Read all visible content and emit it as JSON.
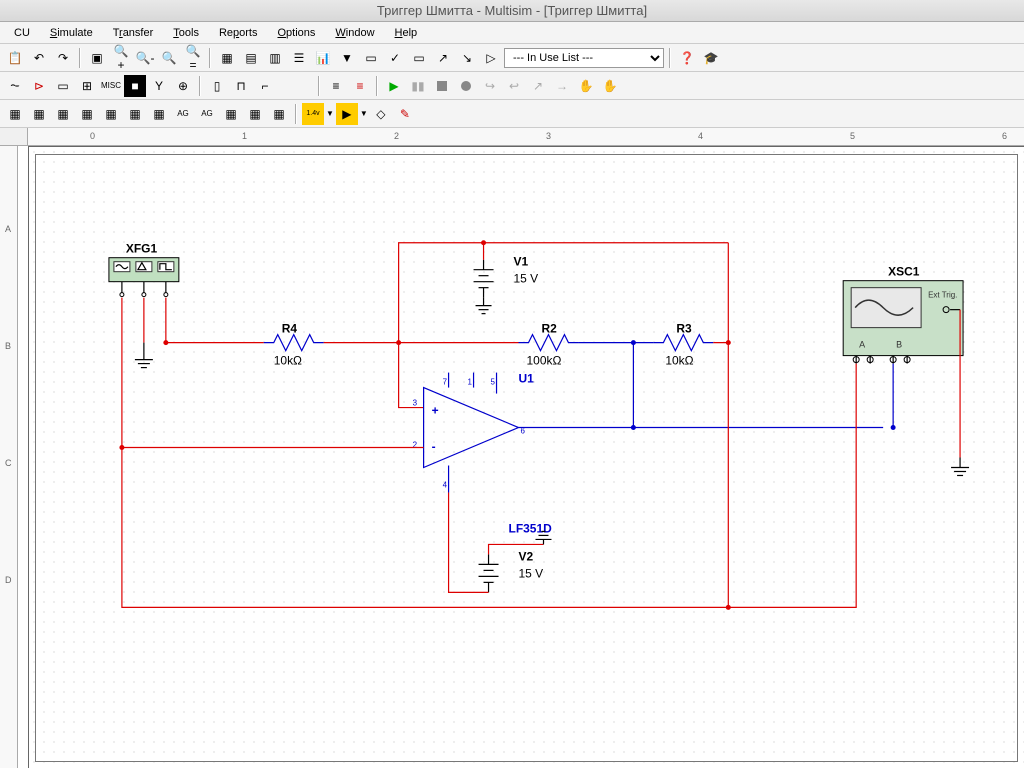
{
  "title": "Триггер Шмитта - Multisim - [Триггер Шмитта]",
  "menu": {
    "cu": "CU",
    "simulate": "Simulate",
    "transfer": "Transfer",
    "tools": "Tools",
    "reports": "Reports",
    "options": "Options",
    "window": "Window",
    "help": "Help"
  },
  "inuse": "--- In Use List ---",
  "ruler_h": [
    "0",
    "1",
    "2",
    "3",
    "4",
    "5",
    "6"
  ],
  "ruler_v": [
    "A",
    "B",
    "C",
    "D"
  ],
  "components": {
    "xfg1": {
      "name": "XFG1"
    },
    "xsc1": {
      "name": "XSC1",
      "a": "A",
      "b": "B",
      "ext": "Ext Trig."
    },
    "r4": {
      "name": "R4",
      "value": "10kΩ"
    },
    "r2": {
      "name": "R2",
      "value": "100kΩ"
    },
    "r3": {
      "name": "R3",
      "value": "10kΩ"
    },
    "v1": {
      "name": "V1",
      "value": "15 V"
    },
    "v2": {
      "name": "V2",
      "value": "15 V"
    },
    "u1": {
      "name": "U1",
      "model": "LF351D",
      "plus": "+",
      "minus": "-"
    },
    "pins": {
      "p1": "1",
      "p2": "2",
      "p3": "3",
      "p4": "4",
      "p5": "5",
      "p6": "6",
      "p7": "7"
    }
  }
}
